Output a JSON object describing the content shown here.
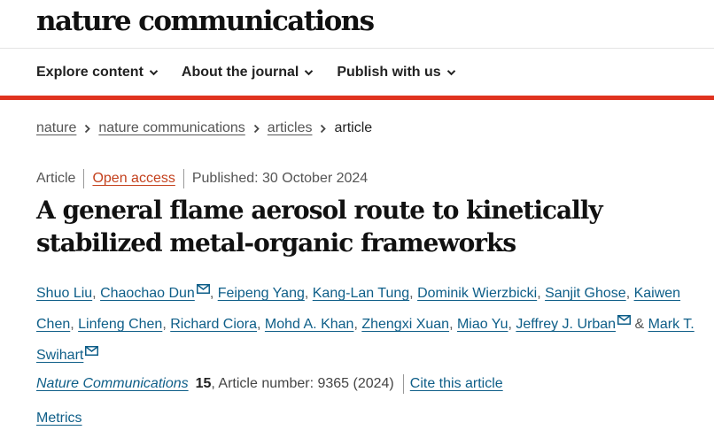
{
  "header": {
    "logo": "nature communications",
    "nav": [
      {
        "label": "Explore content"
      },
      {
        "label": "About the journal"
      },
      {
        "label": "Publish with us"
      }
    ],
    "accent_color": "#e0331f"
  },
  "breadcrumb": [
    "nature",
    "nature communications",
    "articles",
    "article"
  ],
  "article": {
    "type": "Article",
    "access": "Open access",
    "published": "Published: 30 October 2024",
    "title": "A general flame aerosol route to kinetically stabilized metal-organic frameworks",
    "authors": [
      {
        "name": "Shuo Liu"
      },
      {
        "name": "Chaochao Dun",
        "email_icon": true
      },
      {
        "name": "Feipeng Yang"
      },
      {
        "name": "Kang-Lan Tung"
      },
      {
        "name": "Dominik Wierzbicki"
      },
      {
        "name": "Sanjit Ghose"
      },
      {
        "name": "Kaiwen Chen"
      },
      {
        "name": "Linfeng Chen"
      },
      {
        "name": "Richard Ciora"
      },
      {
        "name": "Mohd A. Khan"
      },
      {
        "name": "Zhengxi Xuan"
      },
      {
        "name": "Miao Yu"
      },
      {
        "name": "Jeffrey J. Urban",
        "email_icon": true
      },
      {
        "name": "Mark T. Swihart",
        "email_icon": true
      }
    ],
    "author_separator": ", ",
    "author_last_separator": " & ",
    "journal": "Nature Communications",
    "volume": "15",
    "article_number": ", Article number: 9365 (2024)",
    "cite_label": "Cite this article",
    "metrics_label": "Metrics"
  }
}
